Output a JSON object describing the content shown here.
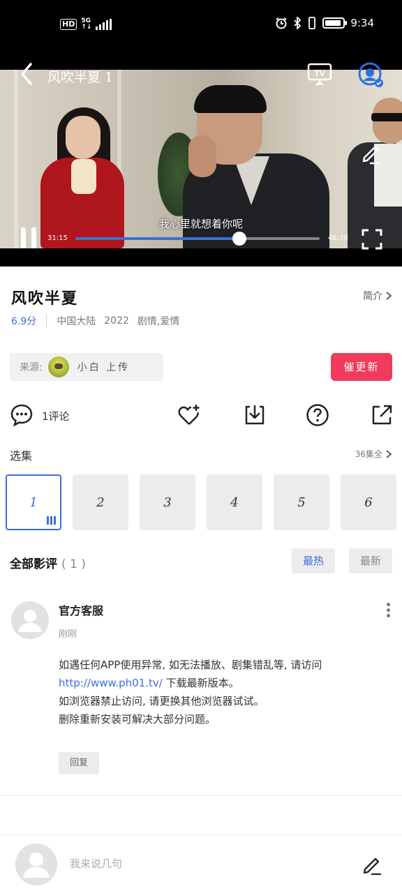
{
  "status_bar": {
    "hd": "HD",
    "net_top": "5G",
    "net_bottom": "↑↓",
    "time": "9:34",
    "battery_level": 0.9
  },
  "player": {
    "title": "风吹半夏 1",
    "subtitle": "我心里就想着你呢",
    "current_time": "31:15",
    "total_time": "46:30",
    "progress": 0.67
  },
  "show": {
    "title": "风吹半夏",
    "intro_label": "简介",
    "rating": "6.9分",
    "region": "中国大陆",
    "year": "2022",
    "genre": "剧情,爱情"
  },
  "source": {
    "label": "来源:",
    "uploader": "小白 上传"
  },
  "update_button": "催更新",
  "actions": {
    "comment_count": "1评论"
  },
  "episodes": {
    "label": "选集",
    "all_label": "36集全",
    "items": [
      "1",
      "2",
      "3",
      "4",
      "5",
      "6"
    ]
  },
  "reviews": {
    "title": "全部影评",
    "count": "( 1 )",
    "sort_hot": "最热",
    "sort_new": "最新"
  },
  "comment": {
    "author": "官方客服",
    "time": "刚刚",
    "line1": "如遇任何APP使用异常, 如无法播放、剧集错乱等, 请访问",
    "link": "http://www.ph01.tv/",
    "line2": " 下载最新版本。",
    "line3": "如浏览器禁止访问, 请更换其他浏览器试试。",
    "line4": "删除重新安装可解决大部分问题。",
    "reply": "回复"
  },
  "bottom_bar": {
    "placeholder": "我来说几句"
  },
  "colors": {
    "accent": "#3a6fd8",
    "update": "#f03b5c"
  }
}
